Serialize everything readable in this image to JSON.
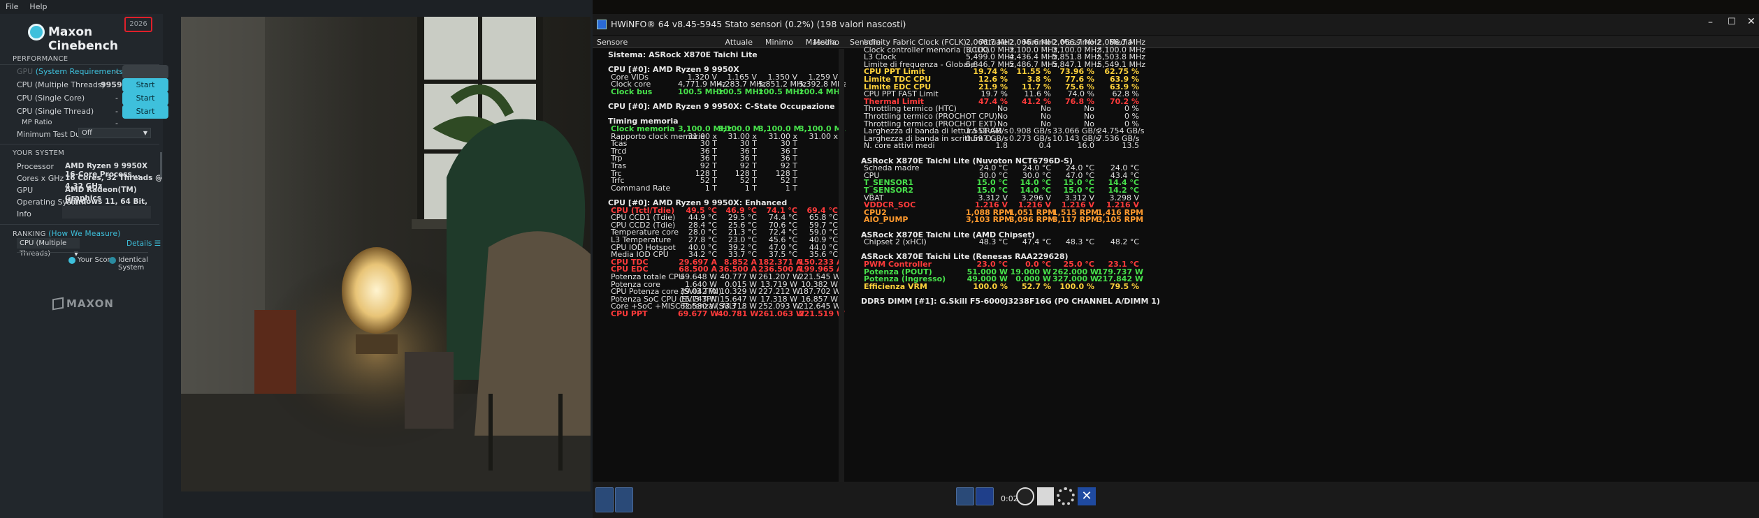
{
  "cinebench": {
    "menu": [
      "File",
      "Help"
    ],
    "version": "2026",
    "brand": "Maxon Cinebench",
    "performance_title": "PERFORMANCE",
    "tests": [
      {
        "name": "GPU",
        "link": "(System Requirements)",
        "score": "-",
        "button": "Start",
        "enabled": false
      },
      {
        "name": "CPU (Multiple Threads)",
        "score": "9959 pts",
        "button": "Start",
        "enabled": true
      },
      {
        "name": "CPU (Single Core)",
        "score": "-",
        "button": "Start",
        "enabled": true
      },
      {
        "name": "CPU (Single Thread)",
        "score": "-",
        "button": "Start",
        "enabled": true
      }
    ],
    "mp_ratio_label": "MP Ratio",
    "mp_ratio_value": "-",
    "min_test_label": "Minimum Test Duration",
    "min_test_value": "Off",
    "system_title": "YOUR SYSTEM",
    "system": [
      {
        "label": "Processor",
        "value": "AMD Ryzen 9 9950X 16-Core Process..."
      },
      {
        "label": "Cores x GHz",
        "value": "16 Cores, 32 Threads @ 4.32 GHz"
      },
      {
        "label": "GPU",
        "value": "AMD Radeon(TM) Graphics"
      },
      {
        "label": "Operating System",
        "value": "Windows 11, 64 Bit, Unknown Editio..."
      },
      {
        "label": "Info",
        "value": ""
      }
    ],
    "ranking_title": "RANKING",
    "ranking_link": "(How We Measure)",
    "ranking_select": "CPU (Multiple Threads)",
    "details": "Details",
    "legend_your": "Your Score",
    "legend_identical": "Identical System",
    "footer_logo": "MAXON",
    "accent": "#3ec0dc"
  },
  "hwinfo": {
    "title": "HWiNFO® 64 v8.45-5945 Stato sensori (0.2%) (198 valori nascosti)",
    "columns": [
      "Sensore",
      "Attuale",
      "Minimo",
      "Massimo",
      "Media"
    ],
    "left_rows": [
      {
        "t": "grp",
        "n": "Sistema: ASRock X870E Taichi Lite",
        "v": [
          "",
          "",
          "",
          ""
        ]
      },
      {
        "t": "sp"
      },
      {
        "t": "grp",
        "n": "CPU [#0]: AMD Ryzen 9 9950X",
        "v": [
          "",
          "",
          "",
          ""
        ]
      },
      {
        "t": "row",
        "n": "Core VIDs",
        "v": [
          "1.320 V",
          "1.165 V",
          "1.350 V",
          "1.259 V"
        ]
      },
      {
        "t": "row",
        "n": "Clock core",
        "v": [
          "4,771.9 MHz",
          "4,283.7 MHz",
          "5,851.2 MHz",
          "5,392.8 MHz"
        ]
      },
      {
        "t": "grn",
        "n": "Clock bus",
        "v": [
          "100.5 MHz",
          "100.5 MHz",
          "100.5 MHz",
          "100.4 MHz"
        ]
      },
      {
        "t": "sp"
      },
      {
        "t": "grp",
        "n": "CPU [#0]: AMD Ryzen 9 9950X: C-State Occupazione",
        "v": [
          "",
          "",
          "",
          ""
        ]
      },
      {
        "t": "sp"
      },
      {
        "t": "grp",
        "n": "Timing memoria",
        "v": [
          "",
          "",
          "",
          ""
        ]
      },
      {
        "t": "grn",
        "n": "Clock memoria",
        "v": [
          "3,100.0 MHz",
          "3,100.0 M...",
          "3,100.0 M...",
          "3,100.0 M..."
        ]
      },
      {
        "t": "row",
        "n": "Rapporto clock memoria",
        "v": [
          "31.00 x",
          "31.00 x",
          "31.00 x",
          "31.00 x"
        ]
      },
      {
        "t": "row",
        "n": "Tcas",
        "v": [
          "30 T",
          "30 T",
          "30 T",
          ""
        ]
      },
      {
        "t": "row",
        "n": "Trcd",
        "v": [
          "36 T",
          "36 T",
          "36 T",
          ""
        ]
      },
      {
        "t": "row",
        "n": "Trp",
        "v": [
          "36 T",
          "36 T",
          "36 T",
          ""
        ]
      },
      {
        "t": "row",
        "n": "Tras",
        "v": [
          "92 T",
          "92 T",
          "92 T",
          ""
        ]
      },
      {
        "t": "row",
        "n": "Trc",
        "v": [
          "128 T",
          "128 T",
          "128 T",
          ""
        ]
      },
      {
        "t": "row",
        "n": "Trfc",
        "v": [
          "52 T",
          "52 T",
          "52 T",
          ""
        ]
      },
      {
        "t": "row",
        "n": "Command Rate",
        "v": [
          "1 T",
          "1 T",
          "1 T",
          ""
        ]
      },
      {
        "t": "sp"
      },
      {
        "t": "grp",
        "n": "CPU [#0]: AMD Ryzen 9 9950X: Enhanced",
        "v": [
          "",
          "",
          "",
          ""
        ]
      },
      {
        "t": "red",
        "n": "CPU (Tctl/Tdie)",
        "v": [
          "49.5 °C",
          "46.9 °C",
          "74.1 °C",
          "69.4 °C"
        ]
      },
      {
        "t": "row",
        "n": "CPU CCD1 (Tdie)",
        "v": [
          "44.9 °C",
          "29.5 °C",
          "74.4 °C",
          "65.8 °C"
        ]
      },
      {
        "t": "row",
        "n": "CPU CCD2 (Tdie)",
        "v": [
          "28.4 °C",
          "25.6 °C",
          "70.6 °C",
          "59.7 °C"
        ]
      },
      {
        "t": "row",
        "n": "Temperature core",
        "v": [
          "28.0 °C",
          "21.3 °C",
          "72.4 °C",
          "59.0 °C"
        ]
      },
      {
        "t": "row",
        "n": "L3 Temperature",
        "v": [
          "27.8 °C",
          "23.0 °C",
          "45.6 °C",
          "40.9 °C"
        ]
      },
      {
        "t": "row",
        "n": "CPU IOD Hotspot",
        "v": [
          "40.0 °C",
          "39.2 °C",
          "47.0 °C",
          "44.0 °C"
        ]
      },
      {
        "t": "row",
        "n": "Media IOD CPU",
        "v": [
          "34.2 °C",
          "33.7 °C",
          "37.5 °C",
          "35.6 °C"
        ]
      },
      {
        "t": "red",
        "n": "CPU TDC",
        "v": [
          "29.697 A",
          "8.852 A",
          "182.371 A",
          "150.233 A"
        ]
      },
      {
        "t": "red",
        "n": "CPU EDC",
        "v": [
          "68.500 A",
          "36.500 A",
          "236.500 A",
          "199.965 A"
        ]
      },
      {
        "t": "row",
        "n": "Potenza totale CPU",
        "v": [
          "69.648 W",
          "40.777 W",
          "261.207 W",
          "221.545 W"
        ]
      },
      {
        "t": "row",
        "n": "Potenza core",
        "v": [
          "1.640 W",
          "0.015 W",
          "13.719 W",
          "10.382 W"
        ]
      },
      {
        "t": "row",
        "n": "CPU Potenza core (SVI3 TFN)",
        "v": [
          "39.042 W",
          "10.329 W",
          "227.212 W",
          "187.702 W"
        ]
      },
      {
        "t": "row",
        "n": "Potenza SoC CPU (SVI3 TFN)",
        "v": [
          "15.743 W",
          "15.647 W",
          "17.318 W",
          "16.857 W"
        ]
      },
      {
        "t": "row",
        "n": "Core +SoC +MISC Potenza (SVI3 ...",
        "v": [
          "62.580 W",
          "33.718 W",
          "252.093 W",
          "212.645 W"
        ]
      },
      {
        "t": "red",
        "n": "CPU PPT",
        "v": [
          "69.677 W",
          "40.781 W",
          "261.063 W",
          "221.519 W"
        ]
      }
    ],
    "right_rows": [
      {
        "t": "row",
        "n": "Infinity Fabric Clock (FCLK)",
        "v": [
          "2,066.7 MHz",
          "2,066.6 MHz",
          "2,066.7 MHz",
          "2,066.7 MHz"
        ]
      },
      {
        "t": "row",
        "n": "Clock controller memoria (UCLK)",
        "v": [
          "3,100.0 MHz",
          "3,100.0 MHz",
          "3,100.0 MHz",
          "3,100.0 MHz"
        ]
      },
      {
        "t": "row",
        "n": "L3 Clock",
        "v": [
          "5,499.0 MHz",
          "4,436.4 MHz",
          "5,851.8 MHz",
          "5,503.8 MHz"
        ]
      },
      {
        "t": "row",
        "n": "Limite di frequenza - Globale",
        "v": [
          "5,846.7 MHz",
          "5,486.7 MHz",
          "5,847.1 MHz",
          "5,549.1 MHz"
        ]
      },
      {
        "t": "yel",
        "n": "CPU PPT Limit",
        "v": [
          "19.74 %",
          "11.55 %",
          "73.96 %",
          "62.75 %"
        ]
      },
      {
        "t": "yel",
        "n": "Limite TDC CPU",
        "v": [
          "12.6 %",
          "3.8 %",
          "77.6 %",
          "63.9 %"
        ]
      },
      {
        "t": "yel",
        "n": "Limite EDC CPU",
        "v": [
          "21.9 %",
          "11.7 %",
          "75.6 %",
          "63.9 %"
        ]
      },
      {
        "t": "row",
        "n": "CPU PPT FAST Limit",
        "v": [
          "19.7 %",
          "11.6 %",
          "74.0 %",
          "62.8 %"
        ]
      },
      {
        "t": "red",
        "n": "Thermal Limit",
        "v": [
          "47.4 %",
          "41.2 %",
          "76.8 %",
          "70.2 %"
        ]
      },
      {
        "t": "row",
        "n": "Throttling termico (HTC)",
        "v": [
          "No",
          "No",
          "No",
          "0 %"
        ]
      },
      {
        "t": "row",
        "n": "Throttling termico (PROCHOT CPU)",
        "v": [
          "No",
          "No",
          "No",
          "0 %"
        ]
      },
      {
        "t": "row",
        "n": "Throttling termico (PROCHOT EXT)",
        "v": [
          "No",
          "No",
          "No",
          "0 %"
        ]
      },
      {
        "t": "row",
        "n": "Larghezza di banda di lettura DRAM",
        "v": [
          "1.551 GB/s",
          "0.908 GB/s",
          "33.066 GB/s",
          "24.754 GB/s"
        ]
      },
      {
        "t": "row",
        "n": "Larghezza di banda in scrittura D...",
        "v": [
          "0.597 GB/s",
          "0.273 GB/s",
          "10.143 GB/s",
          "7.536 GB/s"
        ]
      },
      {
        "t": "row",
        "n": "N. core attivi medi",
        "v": [
          "1.8",
          "0.4",
          "16.0",
          "13.5"
        ]
      },
      {
        "t": "sp"
      },
      {
        "t": "grp",
        "n": "ASRock X870E Taichi Lite (Nuvoton NCT6796D-S)",
        "v": [
          "",
          "",
          "",
          ""
        ]
      },
      {
        "t": "row",
        "n": "Scheda madre",
        "v": [
          "24.0 °C",
          "24.0 °C",
          "24.0 °C",
          "24.0 °C"
        ]
      },
      {
        "t": "row",
        "n": "CPU",
        "v": [
          "30.0 °C",
          "30.0 °C",
          "47.0 °C",
          "43.4 °C"
        ]
      },
      {
        "t": "grn",
        "n": "T_SENSOR1",
        "v": [
          "15.0 °C",
          "14.0 °C",
          "15.0 °C",
          "14.4 °C"
        ]
      },
      {
        "t": "grn",
        "n": "T_SENSOR2",
        "v": [
          "15.0 °C",
          "14.0 °C",
          "15.0 °C",
          "14.2 °C"
        ]
      },
      {
        "t": "row",
        "n": "VBAT",
        "v": [
          "3.312 V",
          "3.296 V",
          "3.312 V",
          "3.298 V"
        ]
      },
      {
        "t": "red",
        "n": "VDDCR_SOC",
        "v": [
          "1.216 V",
          "1.216 V",
          "1.216 V",
          "1.216 V"
        ]
      },
      {
        "t": "org",
        "n": "CPU2",
        "v": [
          "1,088 RPM",
          "1,051 RPM",
          "1,515 RPM",
          "1,416 RPM"
        ]
      },
      {
        "t": "org",
        "n": "AIO_PUMP",
        "v": [
          "3,103 RPM",
          "3,096 RPM",
          "3,117 RPM",
          "3,105 RPM"
        ]
      },
      {
        "t": "sp"
      },
      {
        "t": "grp",
        "n": "ASRock X870E Taichi Lite (AMD Chipset)",
        "v": [
          "",
          "",
          "",
          ""
        ]
      },
      {
        "t": "row",
        "n": "Chipset 2 (xHCI)",
        "v": [
          "48.3 °C",
          "47.4 °C",
          "48.3 °C",
          "48.2 °C"
        ]
      },
      {
        "t": "sp"
      },
      {
        "t": "grp",
        "n": "ASRock X870E Taichi Lite (Renesas RAA229628)",
        "v": [
          "",
          "",
          "",
          ""
        ]
      },
      {
        "t": "red",
        "n": "PWM Controller",
        "v": [
          "23.0 °C",
          "0.0 °C",
          "25.0 °C",
          "23.1 °C"
        ]
      },
      {
        "t": "grn",
        "n": "Potenza (POUT)",
        "v": [
          "51.000 W",
          "19.000 W",
          "262.000 W",
          "179.737 W"
        ]
      },
      {
        "t": "grn",
        "n": "Potenza (Ingresso)",
        "v": [
          "49.000 W",
          "0.000 W",
          "327.000 W",
          "217.842 W"
        ]
      },
      {
        "t": "yel",
        "n": "Efficienza VRM",
        "v": [
          "100.0 %",
          "52.7 %",
          "100.0 %",
          "79.5 %"
        ]
      },
      {
        "t": "sp"
      },
      {
        "t": "grp",
        "n": "DDR5 DIMM [#1]: G.Skill F5-6000J3238F16G (P0 CHANNEL A/DIMM 1)",
        "v": [
          "",
          "",
          "",
          ""
        ]
      }
    ],
    "timer": "0:02:00"
  }
}
